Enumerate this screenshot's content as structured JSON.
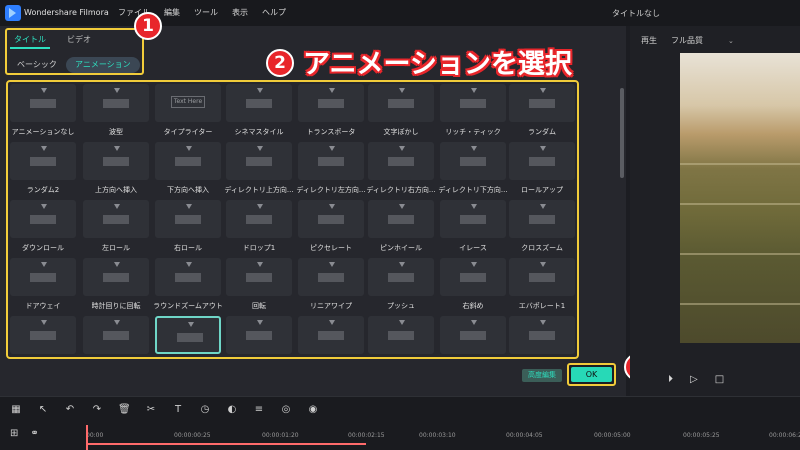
{
  "app": {
    "name": "Wondershare Filmora",
    "doc_title": "タイトルなし"
  },
  "menu": [
    "ファイル",
    "編集",
    "ツール",
    "表示",
    "ヘルプ"
  ],
  "tabs": {
    "title": "タイトル",
    "video": "ビデオ"
  },
  "subtabs": {
    "basic": "ベーシック",
    "animation": "アニメーション"
  },
  "annotations": {
    "badge1": "1",
    "badge2": "2",
    "badge3": "3",
    "callout": "アニメーションを選択"
  },
  "animations": [
    [
      "アニメーションなし",
      "波型",
      "タイプライター",
      "シネマスタイル",
      "トランスポータ",
      "文字ぼかし",
      "リッチ・ティック",
      "ランダム"
    ],
    [
      "ランダム2",
      "上方向へ挿入",
      "下方向へ挿入",
      "ディレクトリ上方向...",
      "ディレクトリ左方向...",
      "ディレクトリ右方向...",
      "ディレクトリ下方向...",
      "ロールアップ"
    ],
    [
      "ダウンロール",
      "左ロール",
      "右ロール",
      "ドロップ1",
      "ピクセレート",
      "ピンホイール",
      "イレース",
      "クロスズーム"
    ],
    [
      "ドアウェイ",
      "時計回りに回転",
      "ラウンドズームアウト",
      "回転",
      "リニアワイプ",
      "プッシュ",
      "右斜め",
      "エバポレート1"
    ],
    [
      "",
      "",
      "",
      "",
      "",
      "",
      "",
      ""
    ]
  ],
  "typewriter_thumb_text": "Text Here",
  "buttons": {
    "advanced": "高度編集",
    "ok": "OK"
  },
  "preview": {
    "label": "再生",
    "quality": "フル品質"
  },
  "timeline": {
    "ticks": [
      "00:00",
      "00:00:00:25",
      "00:00:01:20",
      "00:00:02:15",
      "00:00:03:10",
      "00:00:04:05",
      "00:00:05:00",
      "00:00:05:25",
      "00:00:06:2"
    ]
  },
  "colors": {
    "accent": "#2ee0c0",
    "highlight": "#f1cc3a",
    "badge": "#e8262b"
  }
}
